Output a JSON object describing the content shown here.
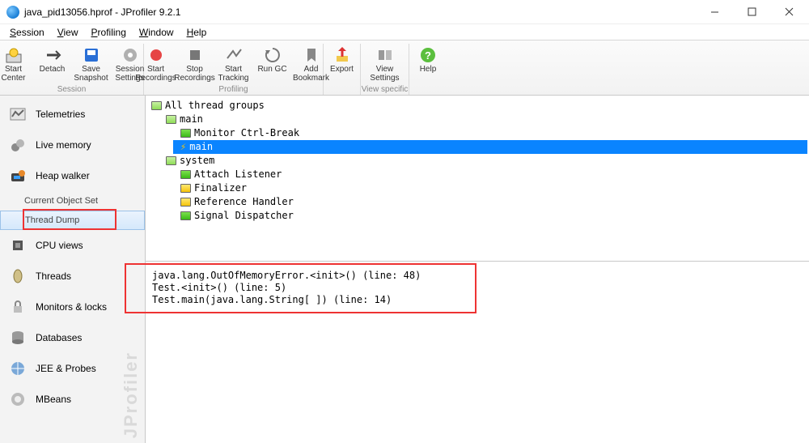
{
  "title": "java_pid13056.hprof - JProfiler 9.2.1",
  "window_controls": {
    "min": "minimize",
    "max": "maximize",
    "close": "close"
  },
  "menu": [
    "Session",
    "View",
    "Profiling",
    "Window",
    "Help"
  ],
  "toolbar_groups": [
    {
      "label": "Session",
      "buttons": [
        {
          "key": "start-center",
          "label": "Start\nCenter"
        },
        {
          "key": "detach",
          "label": "Detach"
        },
        {
          "key": "save-snapshot",
          "label": "Save\nSnapshot"
        },
        {
          "key": "session-settings",
          "label": "Session\nSettings"
        }
      ]
    },
    {
      "label": "Profiling",
      "buttons": [
        {
          "key": "start-recordings",
          "label": "Start\nRecordings"
        },
        {
          "key": "stop-recordings",
          "label": "Stop\nRecordings"
        },
        {
          "key": "start-tracking",
          "label": "Start\nTracking"
        },
        {
          "key": "run-gc",
          "label": "Run GC"
        },
        {
          "key": "add-bookmark",
          "label": "Add\nBookmark"
        }
      ]
    },
    {
      "label": "",
      "buttons": [
        {
          "key": "export",
          "label": "Export"
        }
      ]
    },
    {
      "label": "View specific",
      "buttons": [
        {
          "key": "view-settings",
          "label": "View\nSettings"
        }
      ]
    },
    {
      "label": "",
      "buttons": [
        {
          "key": "help",
          "label": "Help"
        }
      ]
    }
  ],
  "sidebar": {
    "items": [
      {
        "key": "telemetries",
        "label": "Telemetries"
      },
      {
        "key": "live-memory",
        "label": "Live memory"
      },
      {
        "key": "heap-walker",
        "label": "Heap walker"
      },
      {
        "key": "current-object-set",
        "label": "Current Object Set",
        "small": true
      },
      {
        "key": "thread-dump",
        "label": "Thread Dump",
        "small": true,
        "selected": true
      },
      {
        "key": "cpu-views",
        "label": "CPU views"
      },
      {
        "key": "threads",
        "label": "Threads"
      },
      {
        "key": "monitors-locks",
        "label": "Monitors & locks"
      },
      {
        "key": "databases",
        "label": "Databases"
      },
      {
        "key": "jee-probes",
        "label": "JEE & Probes"
      },
      {
        "key": "mbeans",
        "label": "MBeans"
      }
    ],
    "watermark": "JProfiler"
  },
  "tree": {
    "root": "All thread groups",
    "main_group": "main",
    "main_thread_monitor": "Monitor Ctrl-Break",
    "main_thread_main": "main",
    "system_group": "system",
    "system_threads": [
      "Attach Listener",
      "Finalizer",
      "Reference Handler",
      "Signal Dispatcher"
    ]
  },
  "stack": [
    "java.lang.OutOfMemoryError.<init>() (line: 48)",
    "Test.<init>() (line: 5)",
    "Test.main(java.lang.String[ ]) (line: 14)"
  ]
}
